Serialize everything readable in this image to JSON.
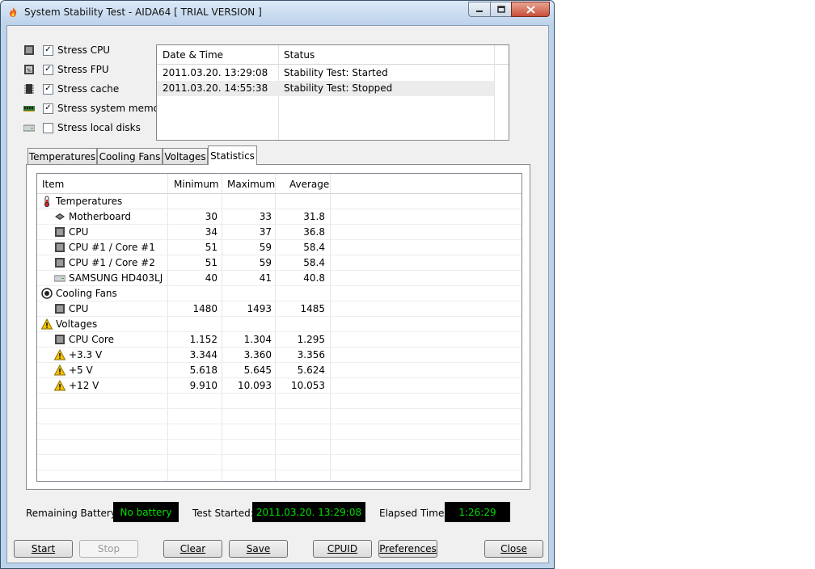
{
  "window": {
    "title": "System Stability Test - AIDA64  [ TRIAL VERSION ]",
    "icon": "flame-icon"
  },
  "stress_options": [
    {
      "label": "Stress CPU",
      "checked": true,
      "icon": "cpu-chip-icon"
    },
    {
      "label": "Stress FPU",
      "checked": true,
      "icon": "fpu-chip-icon"
    },
    {
      "label": "Stress cache",
      "checked": true,
      "icon": "cache-chip-icon"
    },
    {
      "label": "Stress system memory",
      "checked": true,
      "icon": "memory-module-icon"
    },
    {
      "label": "Stress local disks",
      "checked": false,
      "icon": "hard-disk-icon"
    }
  ],
  "log": {
    "columns": [
      "Date & Time",
      "Status"
    ],
    "rows": [
      {
        "datetime": "2011.03.20. 13:29:08",
        "status": "Stability Test: Started"
      },
      {
        "datetime": "2011.03.20. 14:55:38",
        "status": "Stability Test: Stopped"
      }
    ]
  },
  "tabs": [
    {
      "label": "Temperatures",
      "active": false
    },
    {
      "label": "Cooling Fans",
      "active": false
    },
    {
      "label": "Voltages",
      "active": false
    },
    {
      "label": "Statistics",
      "active": true
    }
  ],
  "stats": {
    "columns": [
      "Item",
      "Minimum",
      "Maximum",
      "Average"
    ],
    "rows": [
      {
        "type": "group",
        "icon": "thermometer-icon",
        "name": "Temperatures"
      },
      {
        "type": "item",
        "icon": "motherboard-icon",
        "name": "Motherboard",
        "min": "30",
        "max": "33",
        "avg": "31.8"
      },
      {
        "type": "item",
        "icon": "cpu-chip-icon",
        "name": "CPU",
        "min": "34",
        "max": "37",
        "avg": "36.8"
      },
      {
        "type": "item",
        "icon": "cpu-chip-icon",
        "name": "CPU #1 / Core #1",
        "min": "51",
        "max": "59",
        "avg": "58.4"
      },
      {
        "type": "item",
        "icon": "cpu-chip-icon",
        "name": "CPU #1 / Core #2",
        "min": "51",
        "max": "59",
        "avg": "58.4"
      },
      {
        "type": "item",
        "icon": "hard-disk-icon",
        "name": "SAMSUNG HD403LJ",
        "min": "40",
        "max": "41",
        "avg": "40.8"
      },
      {
        "type": "group",
        "icon": "fan-icon",
        "name": "Cooling Fans"
      },
      {
        "type": "item",
        "icon": "cpu-chip-icon",
        "name": "CPU",
        "min": "1480",
        "max": "1493",
        "avg": "1485"
      },
      {
        "type": "group",
        "icon": "warning-icon",
        "name": "Voltages"
      },
      {
        "type": "item",
        "icon": "cpu-chip-icon",
        "name": "CPU Core",
        "min": "1.152",
        "max": "1.304",
        "avg": "1.295"
      },
      {
        "type": "item",
        "icon": "warning-icon",
        "name": "+3.3 V",
        "min": "3.344",
        "max": "3.360",
        "avg": "3.356"
      },
      {
        "type": "item",
        "icon": "warning-icon",
        "name": "+5 V",
        "min": "5.618",
        "max": "5.645",
        "avg": "5.624"
      },
      {
        "type": "item",
        "icon": "warning-icon",
        "name": "+12 V",
        "min": "9.910",
        "max": "10.093",
        "avg": "10.053"
      }
    ]
  },
  "status_bar": {
    "battery_label": "Remaining Battery:",
    "battery_value": "No battery",
    "started_label": "Test Started:",
    "started_value": "2011.03.20. 13:29:08",
    "elapsed_label": "Elapsed Time:",
    "elapsed_value": "1:26:29"
  },
  "buttons": {
    "start": "Start",
    "stop": "Stop",
    "clear": "Clear",
    "save": "Save",
    "cpuid": "CPUID",
    "preferences": "Preferences",
    "close": "Close"
  },
  "colors": {
    "lcd_background": "#000000",
    "lcd_text": "#00e000",
    "title_gradient_top": "#dce9f7",
    "close_button": "#c7503a"
  }
}
